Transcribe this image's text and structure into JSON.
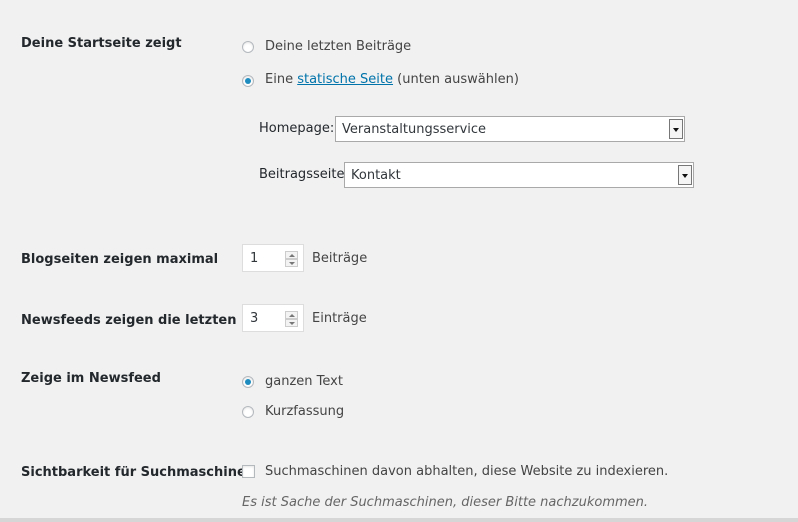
{
  "front_page": {
    "label": "Deine Startseite zeigt",
    "option_latest": "Deine letzten Beiträge",
    "option_static_prefix": "Eine",
    "option_static_link": "statische Seite",
    "option_static_suffix": "(unten auswählen)",
    "selected": "static",
    "homepage_label": "Homepage:",
    "homepage_value": "Veranstaltungsservice",
    "posts_page_label": "Beitragsseite:",
    "posts_page_value": "Kontakt"
  },
  "blog_pages": {
    "label": "Blogseiten zeigen maximal",
    "value": "1",
    "unit": "Beiträge"
  },
  "feeds": {
    "label": "Newsfeeds zeigen die letzten",
    "value": "3",
    "unit": "Einträge"
  },
  "feed_content": {
    "label": "Zeige im Newsfeed",
    "option_full": "ganzen Text",
    "option_summary": "Kurzfassung",
    "selected": "full"
  },
  "search_visibility": {
    "label": "Sichtbarkeit für Suchmaschinen",
    "checkbox_label": "Suchmaschinen davon abhalten, diese Website zu indexieren.",
    "checked": false,
    "description": "Es ist Sache der Suchmaschinen, dieser Bitte nachzukommen."
  },
  "colors": {
    "background": "#f1f1f1",
    "link": "#0073aa",
    "radio_dot": "#1e8cbe"
  }
}
